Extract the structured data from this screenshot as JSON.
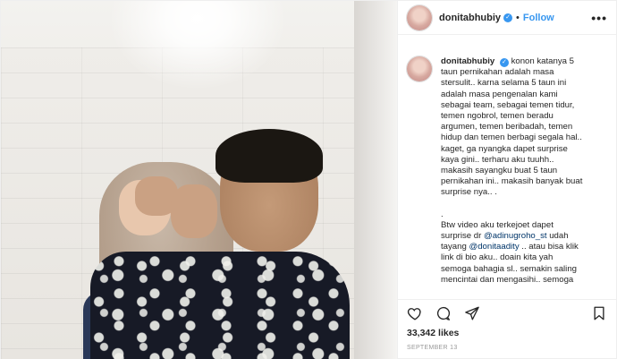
{
  "post": {
    "username": "donitabhubiy",
    "follow_label": "Follow",
    "separator": "•",
    "more_label": "•••",
    "caption_lines": [
      "konon katanya 5",
      "taun pernikahan adalah masa",
      "stersulit.. karna selama 5 taun ini",
      "adalah masa pengenalan kami",
      "sebagai team, sebagai temen tidur,",
      "temen ngobrol, temen beradu",
      "argumen, temen beribadah, temen",
      "hidup dan temen berbagi segala hal..",
      "kaget, ga nyangka dapet surprise",
      "kaya gini.. terharu aku tuuhh..",
      "makasih sayangku buat 5 taun",
      "pernikahan ini.. makasih banyak buat",
      "surprise nya.. ."
    ],
    "caption_dot": ".",
    "caption2": {
      "line1": "Btw video aku terkejoet dapet",
      "line2_prefix": "surprise dr ",
      "mention1": "@adinugroho_st",
      "line2_suffix": " udah",
      "line3_prefix": "tayang ",
      "mention2": "@donitaadity",
      "line3_suffix": " .. atau bisa klik",
      "line4": "link di bio aku.. doain kita yah",
      "line5": "semoga bahagia sl.. semakin saling",
      "line6": "mencintai dan mengasihi.. semoga"
    },
    "likes": "33,342 likes",
    "date": "SEPTEMBER 13"
  },
  "icons": {
    "verified": "verified-badge-icon",
    "heart": "heart-icon",
    "comment": "comment-icon",
    "share": "share-icon",
    "save": "bookmark-icon"
  },
  "colors": {
    "accent": "#3897f0",
    "text": "#262626",
    "muted": "#999999",
    "mention": "#003569"
  }
}
